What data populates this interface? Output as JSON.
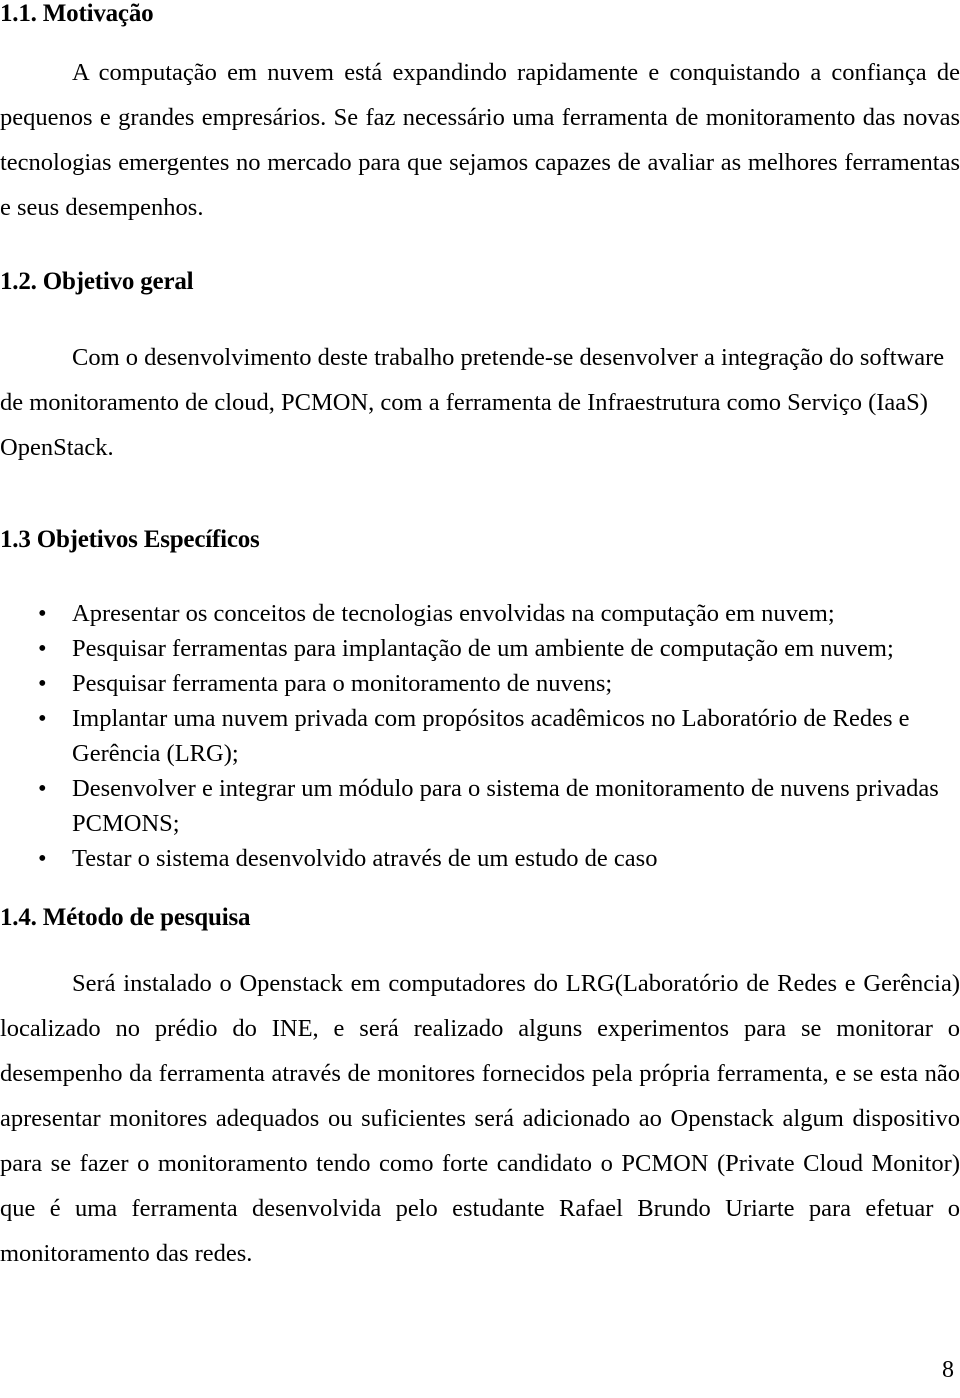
{
  "document": {
    "page_number": "8",
    "sections": [
      {
        "id": "motivacao",
        "heading": "1.1. Motivação",
        "paragraphs": [
          "A computação em nuvem está expandindo rapidamente e conquistando a confiança de pequenos e grandes empresários. Se faz necessário uma ferramenta de monitoramento das novas tecnologias emergentes no mercado para que sejamos capazes de avaliar as melhores ferramentas e seus desempenhos."
        ]
      },
      {
        "id": "objetivo-geral",
        "heading": "1.2. Objetivo geral",
        "paragraphs": [
          "Com o desenvolvimento deste trabalho pretende-se desenvolver a integração do software de monitoramento de cloud, PCMON, com a ferramenta de Infraestrutura como Serviço (IaaS) OpenStack."
        ]
      },
      {
        "id": "objetivos-especificos",
        "heading": "1.3 Objetivos Específicos",
        "bullet_marker": "•",
        "bullets": [
          "Apresentar os conceitos de tecnologias envolvidas na computação em nuvem;",
          "Pesquisar ferramentas para implantação de um ambiente de computação em nuvem;",
          "Pesquisar ferramenta para o monitoramento de nuvens;",
          "Implantar uma nuvem privada com propósitos acadêmicos no Laboratório de Redes e Gerência (LRG);",
          "Desenvolver e integrar um módulo para o sistema de monitoramento de nuvens privadas PCMONS;",
          "Testar o sistema desenvolvido através de um estudo de caso"
        ]
      },
      {
        "id": "metodo-de-pesquisa",
        "heading": "1.4. Método de pesquisa",
        "paragraphs": [
          "Será instalado o Openstack em computadores do LRG(Laboratório de Redes e Gerência) localizado no prédio do INE, e será realizado alguns experimentos para se monitorar o desempenho da ferramenta através de monitores fornecidos pela própria ferramenta, e se esta não apresentar monitores adequados ou suficientes será adicionado ao Openstack algum dispositivo para se fazer o monitoramento tendo como forte candidato o PCMON (Private Cloud Monitor) que é uma ferramenta desenvolvida pelo estudante Rafael Brundo Uriarte para efetuar o monitoramento das redes."
        ]
      }
    ]
  }
}
